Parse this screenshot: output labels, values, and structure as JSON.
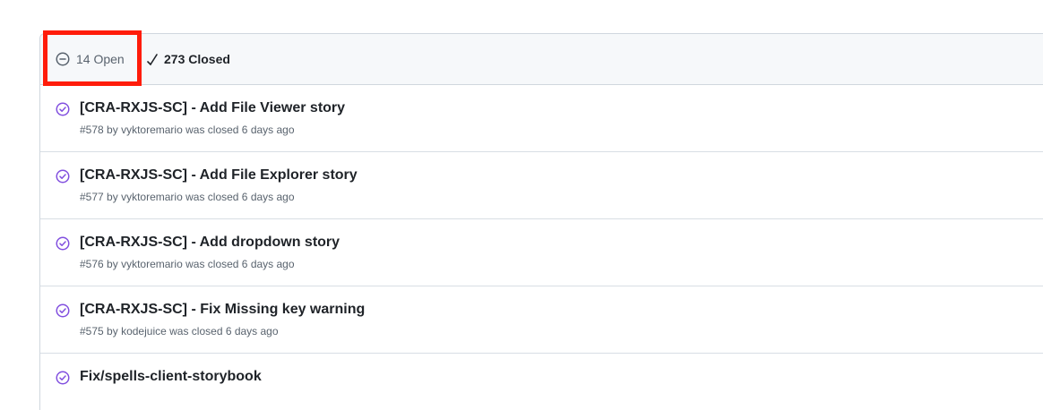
{
  "header": {
    "open_label": "14 Open",
    "closed_label": "273 Closed"
  },
  "pulls": [
    {
      "title": "[CRA-RXJS-SC] - Add File Viewer story",
      "number": "#578",
      "by": "by",
      "author": "vyktoremario",
      "status_text": "was closed 6 days ago"
    },
    {
      "title": "[CRA-RXJS-SC] - Add File Explorer story",
      "number": "#577",
      "by": "by",
      "author": "vyktoremario",
      "status_text": "was closed 6 days ago"
    },
    {
      "title": "[CRA-RXJS-SC] - Add dropdown story",
      "number": "#576",
      "by": "by",
      "author": "vyktoremario",
      "status_text": "was closed 6 days ago"
    },
    {
      "title": "[CRA-RXJS-SC] - Fix Missing key warning",
      "number": "#575",
      "by": "by",
      "author": "kodejuice",
      "status_text": "was closed 6 days ago"
    },
    {
      "title": "Fix/spells-client-storybook",
      "number": "",
      "by": "",
      "author": "",
      "status_text": ""
    }
  ],
  "colors": {
    "merged_purple": "#8250df",
    "highlight_red": "#ff1c0a",
    "muted_text": "#59636e"
  },
  "icons": {
    "open_state": "circle-minus-icon",
    "closed_state": "check-icon",
    "row_status": "check-circle-icon"
  }
}
